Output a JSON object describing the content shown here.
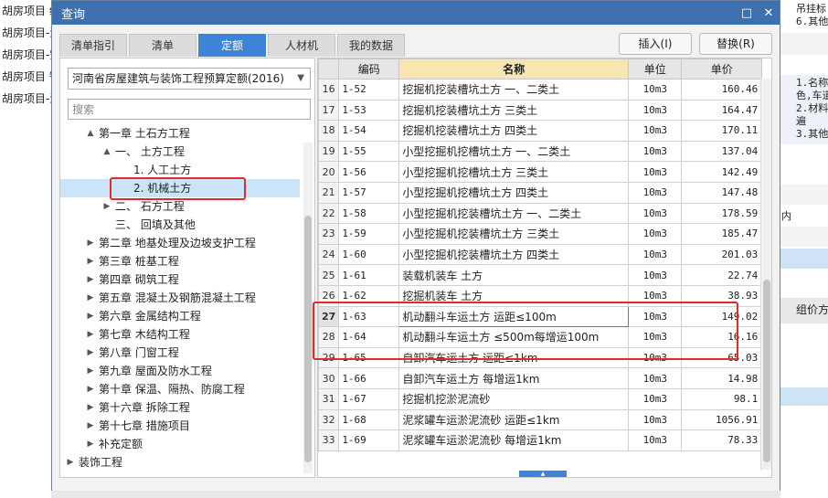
{
  "background_left": [
    "胡房项目 给",
    "胡房项目-消",
    "胡房项目-空",
    "胡房项目 智",
    "胡房项目-消"
  ],
  "background_right": {
    "top_lines": [
      "吊挂标",
      "6.其他"
    ],
    "mid_lines": [
      "1.名称",
      "色,车道",
      "2.材料",
      "遍",
      "3.其他"
    ],
    "row_text": "内",
    "panel_label": "组价方"
  },
  "dialog": {
    "title": "查询",
    "tabs": [
      "清单指引",
      "清单",
      "定额",
      "人材机",
      "我的数据"
    ],
    "active_tab": 2,
    "insert_label": "插入(I)",
    "replace_label": "替换(R)"
  },
  "library": {
    "selected": "河南省房屋建筑与装饰工程预算定额(2016)",
    "search_placeholder": "搜索"
  },
  "tree": [
    {
      "label": "第一章 土石方工程",
      "toggle": "▲"
    },
    {
      "label": "一、 土方工程",
      "toggle": "▲"
    },
    {
      "label": "1. 人工土方",
      "toggle": ""
    },
    {
      "label": "2. 机械土方",
      "toggle": ""
    },
    {
      "label": "二、 石方工程",
      "toggle": "▶"
    },
    {
      "label": "三、 回填及其他",
      "toggle": ""
    },
    {
      "label": "第二章 地基处理及边坡支护工程",
      "toggle": "▶"
    },
    {
      "label": "第三章 桩基工程",
      "toggle": "▶"
    },
    {
      "label": "第四章 砌筑工程",
      "toggle": "▶"
    },
    {
      "label": "第五章 混凝土及钢筋混凝土工程",
      "toggle": "▶"
    },
    {
      "label": "第六章 金属结构工程",
      "toggle": "▶"
    },
    {
      "label": "第七章 木结构工程",
      "toggle": "▶"
    },
    {
      "label": "第八章 门窗工程",
      "toggle": "▶"
    },
    {
      "label": "第九章 屋面及防水工程",
      "toggle": "▶"
    },
    {
      "label": "第十章 保温、隔热、防腐工程",
      "toggle": "▶"
    },
    {
      "label": "第十六章 拆除工程",
      "toggle": "▶"
    },
    {
      "label": "第十七章 措施项目",
      "toggle": "▶"
    },
    {
      "label": "补充定额",
      "toggle": "▶"
    },
    {
      "label": "装饰工程",
      "toggle": "▶"
    }
  ],
  "grid": {
    "headers": [
      "",
      "编码",
      "名称",
      "单位",
      "单价"
    ],
    "rows": [
      {
        "num": "16",
        "code": "1-52",
        "name": "挖掘机挖装槽坑土方 一、二类土",
        "unit": "10m3",
        "price": "160.46"
      },
      {
        "num": "17",
        "code": "1-53",
        "name": "挖掘机挖装槽坑土方 三类土",
        "unit": "10m3",
        "price": "164.47"
      },
      {
        "num": "18",
        "code": "1-54",
        "name": "挖掘机挖装槽坑土方 四类土",
        "unit": "10m3",
        "price": "170.11"
      },
      {
        "num": "19",
        "code": "1-55",
        "name": "小型挖掘机挖槽坑土方 一、二类土",
        "unit": "10m3",
        "price": "137.04"
      },
      {
        "num": "20",
        "code": "1-56",
        "name": "小型挖掘机挖槽坑土方 三类土",
        "unit": "10m3",
        "price": "142.49"
      },
      {
        "num": "21",
        "code": "1-57",
        "name": "小型挖掘机挖槽坑土方 四类土",
        "unit": "10m3",
        "price": "147.48"
      },
      {
        "num": "22",
        "code": "1-58",
        "name": "小型挖掘机挖装槽坑土方 一、二类土",
        "unit": "10m3",
        "price": "178.59"
      },
      {
        "num": "23",
        "code": "1-59",
        "name": "小型挖掘机挖装槽坑土方 三类土",
        "unit": "10m3",
        "price": "185.47"
      },
      {
        "num": "24",
        "code": "1-60",
        "name": "小型挖掘机挖装槽坑土方 四类土",
        "unit": "10m3",
        "price": "201.03"
      },
      {
        "num": "25",
        "code": "1-61",
        "name": "装载机装车 土方",
        "unit": "10m3",
        "price": "22.74"
      },
      {
        "num": "26",
        "code": "1-62",
        "name": "挖掘机装车 土方",
        "unit": "10m3",
        "price": "38.93"
      },
      {
        "num": "27",
        "code": "1-63",
        "name": "机动翻斗车运土方 运距≤100m",
        "unit": "10m3",
        "price": "149.02"
      },
      {
        "num": "28",
        "code": "1-64",
        "name": "机动翻斗车运土方 ≤500m每增运100m",
        "unit": "10m3",
        "price": "16.16"
      },
      {
        "num": "29",
        "code": "1-65",
        "name": "自卸汽车运土方 运距≤1km",
        "unit": "10m3",
        "price": "65.03"
      },
      {
        "num": "30",
        "code": "1-66",
        "name": "自卸汽车运土方 每增运1km",
        "unit": "10m3",
        "price": "14.98"
      },
      {
        "num": "31",
        "code": "1-67",
        "name": "挖掘机挖淤泥流砂",
        "unit": "10m3",
        "price": "98.1"
      },
      {
        "num": "32",
        "code": "1-68",
        "name": "泥浆罐车运淤泥流砂 运距≤1km",
        "unit": "10m3",
        "price": "1056.91"
      },
      {
        "num": "33",
        "code": "1-69",
        "name": "泥浆罐车运淤泥流砂 每增运1km",
        "unit": "10m3",
        "price": "78.33"
      }
    ]
  },
  "colors": {
    "titlebar": "#3e6fae",
    "active_tab": "#3d84d6",
    "highlight_box": "#e32a2a",
    "name_header": "#f7e6b1"
  }
}
